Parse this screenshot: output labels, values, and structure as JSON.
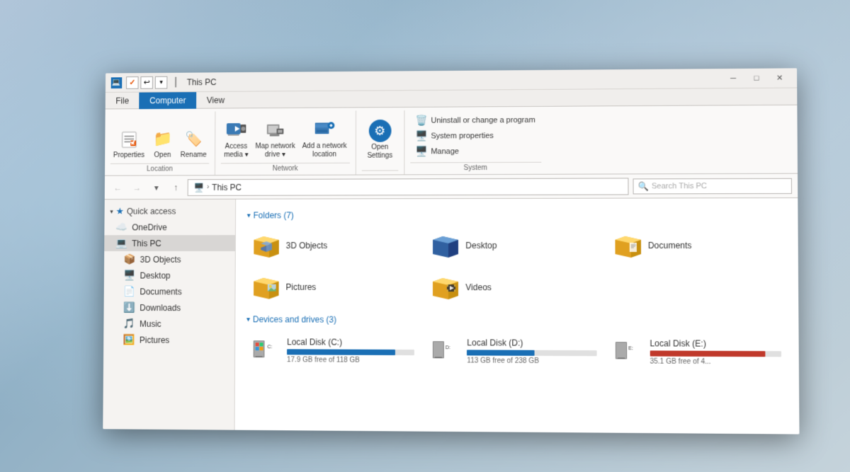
{
  "window": {
    "title": "This PC",
    "titlebar_icon": "💻",
    "qs_save": "✓",
    "qs_undo": "↩"
  },
  "ribbon": {
    "tabs": [
      {
        "label": "File",
        "active": false
      },
      {
        "label": "Computer",
        "active": true
      },
      {
        "label": "View",
        "active": false
      }
    ],
    "groups": {
      "location": {
        "label": "Location",
        "items": [
          {
            "label": "Properties",
            "icon": "📋"
          },
          {
            "label": "Open",
            "icon": "📂"
          },
          {
            "label": "Rename",
            "icon": "✏️"
          }
        ]
      },
      "network": {
        "label": "Network",
        "items": [
          {
            "label": "Access\nmedia",
            "icon": "🖥️"
          },
          {
            "label": "Map network\ndrive",
            "icon": "🗺️"
          },
          {
            "label": "Add a network\nlocation",
            "icon": "🖥️"
          }
        ]
      },
      "system": {
        "label": "System",
        "open_settings_label": "Open\nSettings",
        "items": [
          {
            "label": "Uninstall or change a program",
            "icon": "🗑️"
          },
          {
            "label": "System properties",
            "icon": "🖥️"
          },
          {
            "label": "Manage",
            "icon": "🖥️"
          }
        ]
      }
    }
  },
  "address_bar": {
    "path": "This PC",
    "path_separator": "›"
  },
  "sidebar": {
    "items": [
      {
        "label": "Quick access",
        "icon": "⭐",
        "section": true,
        "expanded": true
      },
      {
        "label": "OneDrive",
        "icon": "☁️"
      },
      {
        "label": "This PC",
        "icon": "🖥️",
        "active": true
      },
      {
        "label": "3D Objects",
        "icon": "📦",
        "indent": true
      },
      {
        "label": "Desktop",
        "icon": "🖥️",
        "indent": true
      },
      {
        "label": "Documents",
        "icon": "📄",
        "indent": true
      },
      {
        "label": "Downloads",
        "icon": "⬇️",
        "indent": true
      },
      {
        "label": "Music",
        "icon": "🎵",
        "indent": true
      },
      {
        "label": "Pictures",
        "icon": "🖼️",
        "indent": true
      }
    ]
  },
  "folders_section": {
    "header": "Folders (7)",
    "items": [
      {
        "name": "3D Objects",
        "type": "3d"
      },
      {
        "name": "Desktop",
        "type": "desktop"
      },
      {
        "name": "Documents",
        "type": "documents"
      },
      {
        "name": "Pictures",
        "type": "pictures"
      },
      {
        "name": "Videos",
        "type": "videos"
      }
    ]
  },
  "drives_section": {
    "header": "Devices and drives (3)",
    "items": [
      {
        "name": "Local Disk (C:)",
        "free": "17.9 GB free of 118 GB",
        "used_pct": 85,
        "color": "blue"
      },
      {
        "name": "Local Disk (D:)",
        "free": "113 GB free of 238 GB",
        "used_pct": 52,
        "color": "blue"
      },
      {
        "name": "Local Disk (E:)",
        "free": "35.1 GB free of 4...",
        "used_pct": 88,
        "color": "red"
      }
    ]
  }
}
